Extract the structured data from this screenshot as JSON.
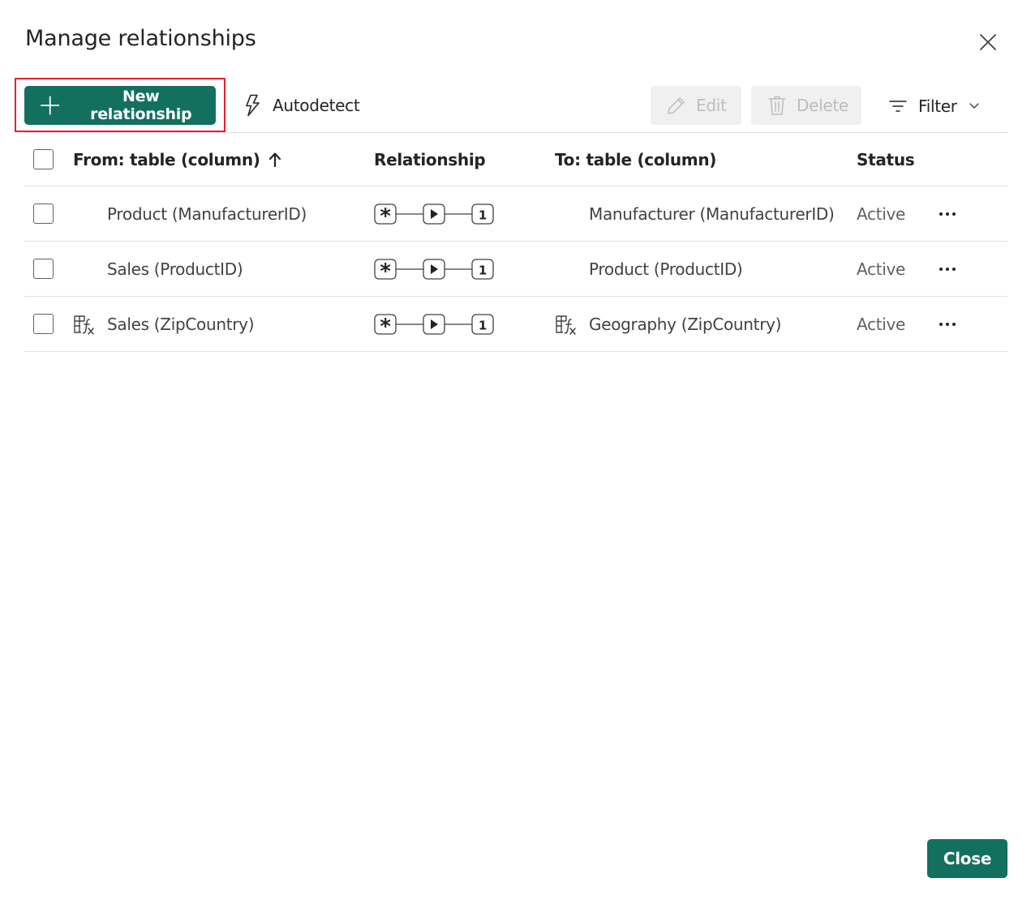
{
  "dialog": {
    "title": "Manage relationships",
    "close_icon": "close-icon"
  },
  "toolbar": {
    "new_label": "New relationship",
    "new_icon": "plus-icon",
    "autodetect_label": "Autodetect",
    "autodetect_icon": "lightning-icon",
    "edit_label": "Edit",
    "edit_icon": "pencil-icon",
    "delete_label": "Delete",
    "delete_icon": "trash-icon",
    "filter_label": "Filter",
    "filter_icon": "filter-icon"
  },
  "table": {
    "headers": {
      "from": "From: table (column)",
      "relationship": "Relationship",
      "to": "To: table (column)",
      "status": "Status"
    },
    "sort": "ascending",
    "rows": [
      {
        "from": "Product (ManufacturerID)",
        "from_calc": false,
        "cardinality_from": "*",
        "cardinality_to": "1",
        "to": "Manufacturer (ManufacturerID)",
        "to_calc": false,
        "status": "Active"
      },
      {
        "from": "Sales (ProductID)",
        "from_calc": false,
        "cardinality_from": "*",
        "cardinality_to": "1",
        "to": "Product (ProductID)",
        "to_calc": false,
        "status": "Active"
      },
      {
        "from": "Sales (ZipCountry)",
        "from_calc": true,
        "cardinality_from": "*",
        "cardinality_to": "1",
        "to": "Geography (ZipCountry)",
        "to_calc": true,
        "status": "Active"
      }
    ]
  },
  "footer": {
    "close_label": "Close"
  },
  "colors": {
    "primary": "#13705f",
    "highlight": "#e8202a",
    "disabled_bg": "#f0f0f0",
    "disabled_text": "#bdbdbd"
  }
}
